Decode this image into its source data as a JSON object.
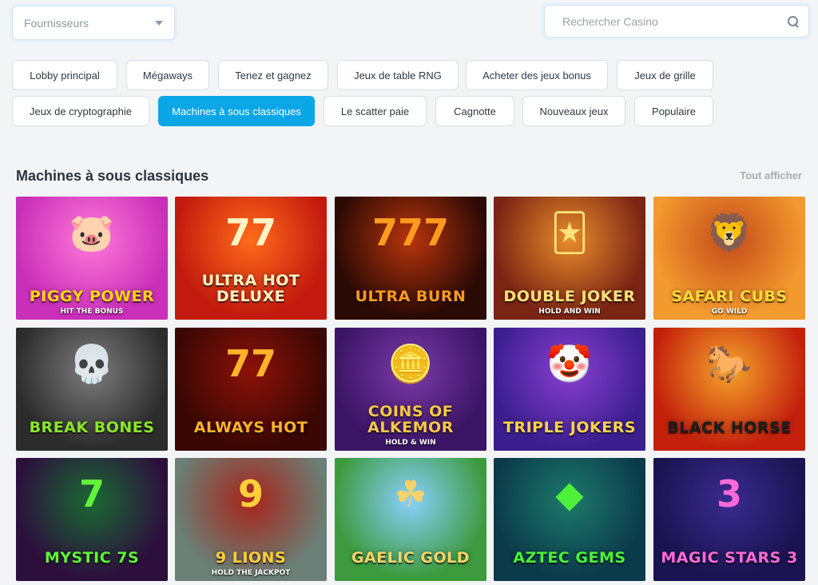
{
  "filters": {
    "provider_placeholder": "Fournisseurs",
    "search_placeholder": "Rechercher Casino"
  },
  "categories": [
    {
      "label": "Lobby principal",
      "active": false
    },
    {
      "label": "Mégaways",
      "active": false
    },
    {
      "label": "Tenez et gagnez",
      "active": false
    },
    {
      "label": "Jeux de table RNG",
      "active": false
    },
    {
      "label": "Acheter des jeux bonus",
      "active": false
    },
    {
      "label": "Jeux de grille",
      "active": false
    },
    {
      "label": "Jeux de cryptographie",
      "active": false
    },
    {
      "label": "Machines à sous classiques",
      "active": true
    },
    {
      "label": "Le scatter paie",
      "active": false
    },
    {
      "label": "Cagnotte",
      "active": false
    },
    {
      "label": "Nouveaux jeux",
      "active": false
    },
    {
      "label": "Populaire",
      "active": false
    }
  ],
  "section": {
    "title": "Machines à sous classiques",
    "view_all": "Tout afficher"
  },
  "games": [
    {
      "title": "Piggy Power",
      "subtitle": "Hit the Bonus",
      "deco": "🐷",
      "bg": "#c92fb8",
      "bg2": "#ff7ad9",
      "fg": "#ffd21a"
    },
    {
      "title": "Ultra Hot Deluxe",
      "deco": "77",
      "bg": "#c21a0e",
      "bg2": "#ff6b1a",
      "fg": "#fff2c4"
    },
    {
      "title": "Ultra Burn",
      "deco": "777",
      "bg": "#2a0a05",
      "bg2": "#b8340c",
      "fg": "#ff9a1f"
    },
    {
      "title": "Double Joker",
      "subtitle": "Hold and Win",
      "deco": "🃏",
      "bg": "#7a2413",
      "bg2": "#e88c2b",
      "fg": "#ffe27a"
    },
    {
      "title": "Safari Cubs",
      "subtitle": "Go Wild",
      "deco": "🦁",
      "bg": "#f29a2e",
      "bg2": "#c44b1a",
      "fg": "#ffd83a"
    },
    {
      "title": "Break Bones",
      "deco": "💀",
      "bg": "#2c2c2c",
      "bg2": "#7d7d7d",
      "fg": "#8be62a"
    },
    {
      "title": "Always Hot",
      "deco": "77",
      "bg": "#3a0704",
      "bg2": "#8c1208",
      "fg": "#ffb32a"
    },
    {
      "title": "Coins of Alkemor",
      "subtitle": "Hold & Win",
      "deco": "🪙",
      "bg": "#3a1565",
      "bg2": "#7b3aa8",
      "fg": "#f7c846"
    },
    {
      "title": "Triple Jokers",
      "deco": "🤡",
      "bg": "#3b1f8f",
      "bg2": "#8a3fd1",
      "fg": "#ffd34a"
    },
    {
      "title": "Black Horse",
      "deco": "🐎",
      "bg": "#c3210c",
      "bg2": "#f5a42a",
      "fg": "#1c1c1c"
    },
    {
      "title": "Mystic 7s",
      "deco": "7",
      "bg": "#2c0f3d",
      "bg2": "#1a6a32",
      "fg": "#62f23a"
    },
    {
      "title": "9 Lions",
      "subtitle": "Hold the Jackpot",
      "deco": "9",
      "bg": "#6a7f76",
      "bg2": "#a8241a",
      "fg": "#ffcf3a"
    },
    {
      "title": "Gaelic Gold",
      "deco": "☘",
      "bg": "#3d9a3d",
      "bg2": "#8ad0ff",
      "fg": "#f4d36a"
    },
    {
      "title": "Aztec Gems",
      "deco": "◆",
      "bg": "#0b3a4a",
      "bg2": "#1c7a6a",
      "fg": "#4df03a"
    },
    {
      "title": "Magic Stars 3",
      "deco": "3",
      "bg": "#1a1450",
      "bg2": "#3a2a90",
      "fg": "#ff6ad8"
    }
  ],
  "colors": {
    "accent": "#0ba6e6",
    "background": "#f2f4f6",
    "text": "#2a3540"
  }
}
